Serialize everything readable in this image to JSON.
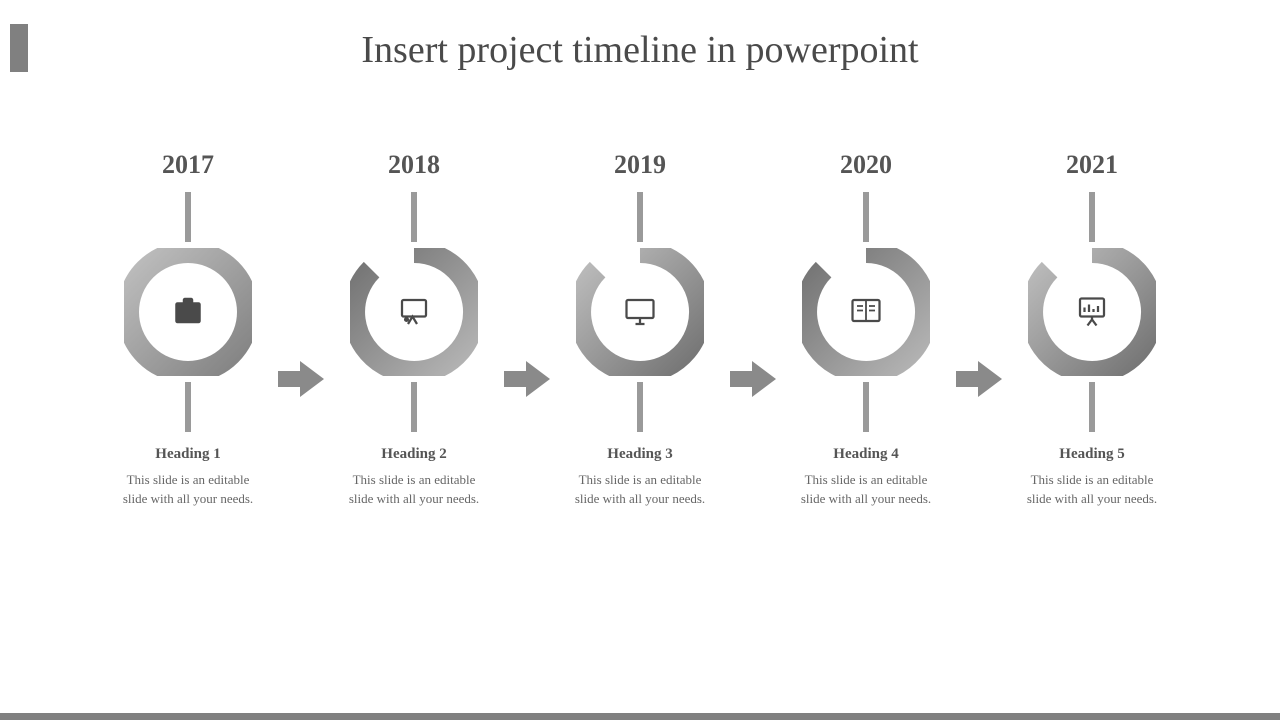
{
  "title": "Insert project timeline in powerpoint",
  "steps": [
    {
      "year": "2017",
      "heading": "Heading 1",
      "desc": "This slide is an editable slide with all your needs.",
      "icon": "briefcase-icon"
    },
    {
      "year": "2018",
      "heading": "Heading 2",
      "desc": "This slide is an editable slide with all your needs.",
      "icon": "presentation-icon"
    },
    {
      "year": "2019",
      "heading": "Heading 3",
      "desc": "This slide is an editable slide with all your needs.",
      "icon": "monitor-icon"
    },
    {
      "year": "2020",
      "heading": "Heading 4",
      "desc": "This slide is an editable slide with all your needs.",
      "icon": "book-icon"
    },
    {
      "year": "2021",
      "heading": "Heading 5",
      "desc": "This slide is an editable slide with all your needs.",
      "icon": "chart-board-icon"
    }
  ],
  "colors": {
    "light": "#b0b0b0",
    "dark": "#707070",
    "arrow": "#8a8a8a"
  }
}
